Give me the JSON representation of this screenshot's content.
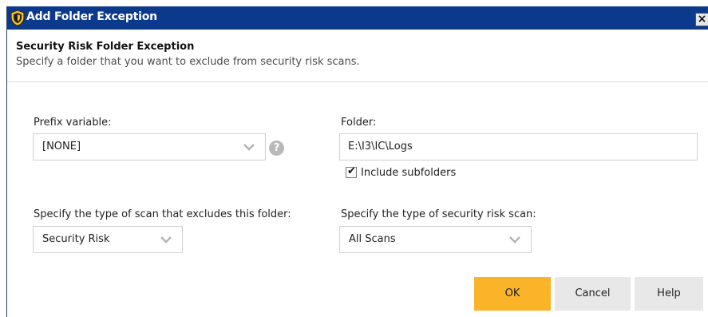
{
  "window": {
    "title": "Add Folder Exception",
    "close_label": "×"
  },
  "header": {
    "title": "Security Risk Folder Exception",
    "subtitle": "Specify a folder that you want to exclude from security risk scans."
  },
  "prefix": {
    "label": "Prefix variable:",
    "value": "[NONE]",
    "help_glyph": "?"
  },
  "folder": {
    "label": "Folder:",
    "value": "E:\\I3\\IC\\Logs",
    "include_subfolders_label": "Include subfolders",
    "include_subfolders_checked": true
  },
  "scan_type": {
    "label": "Specify the type of scan that excludes this folder:",
    "value": "Security Risk"
  },
  "risk_scan_type": {
    "label": "Specify the type of security risk scan:",
    "value": "All Scans"
  },
  "buttons": {
    "ok": "OK",
    "cancel": "Cancel",
    "help": "Help"
  },
  "colors": {
    "titlebar": "#0b3a8c",
    "primary_button": "#fbb42a",
    "secondary_button": "#e8e8e8"
  },
  "icons": {
    "title": "shield-icon",
    "dropdown": "chevron-down-icon",
    "help": "help-icon",
    "check": "checkmark-icon"
  }
}
